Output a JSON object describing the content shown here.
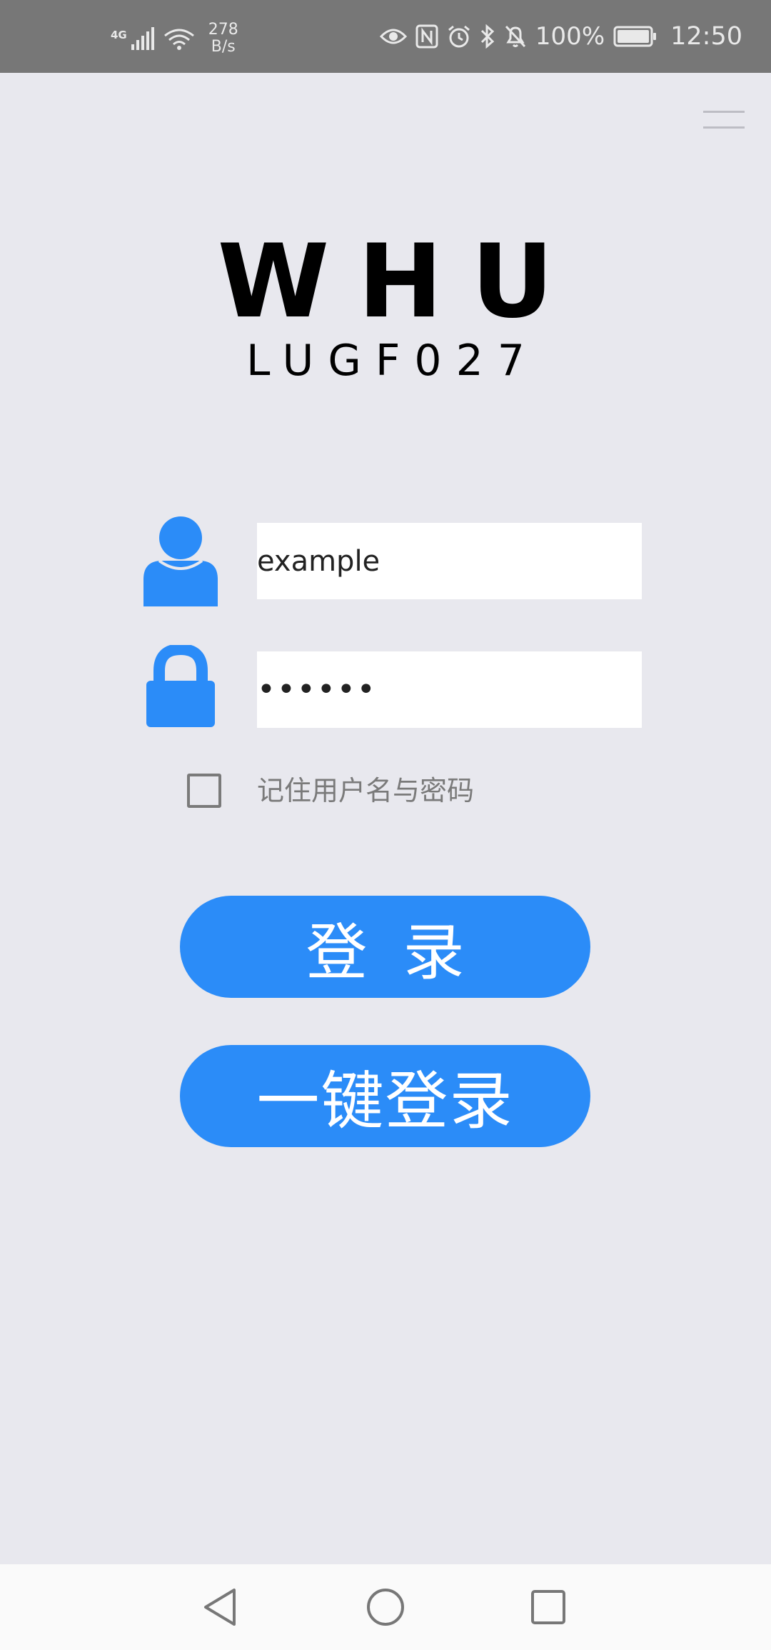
{
  "status_bar": {
    "network": "4G",
    "speed_value": "278",
    "speed_unit": "B/s",
    "battery": "100%",
    "time": "12:50",
    "icons": [
      "signal-icon",
      "wifi-icon",
      "eye-icon",
      "nfc-icon",
      "alarm-icon",
      "bluetooth-icon",
      "mute-icon",
      "battery-icon"
    ]
  },
  "menu": {
    "icon": "menu-icon"
  },
  "logo": {
    "title": "WHU",
    "subtitle": "LUGF027"
  },
  "form": {
    "username_value": "example",
    "password_value": "••••••",
    "username_icon": "user-icon",
    "password_icon": "lock-icon",
    "remember_label": "记住用户名与密码",
    "remember_checked": false
  },
  "buttons": {
    "login": "登录",
    "one_click_login": "一键登录"
  },
  "colors": {
    "accent": "#2B8CF8",
    "background": "#E8E8EE",
    "status_bar": "#777777"
  },
  "nav": {
    "icons": [
      "back-icon",
      "home-icon",
      "recents-icon"
    ]
  }
}
